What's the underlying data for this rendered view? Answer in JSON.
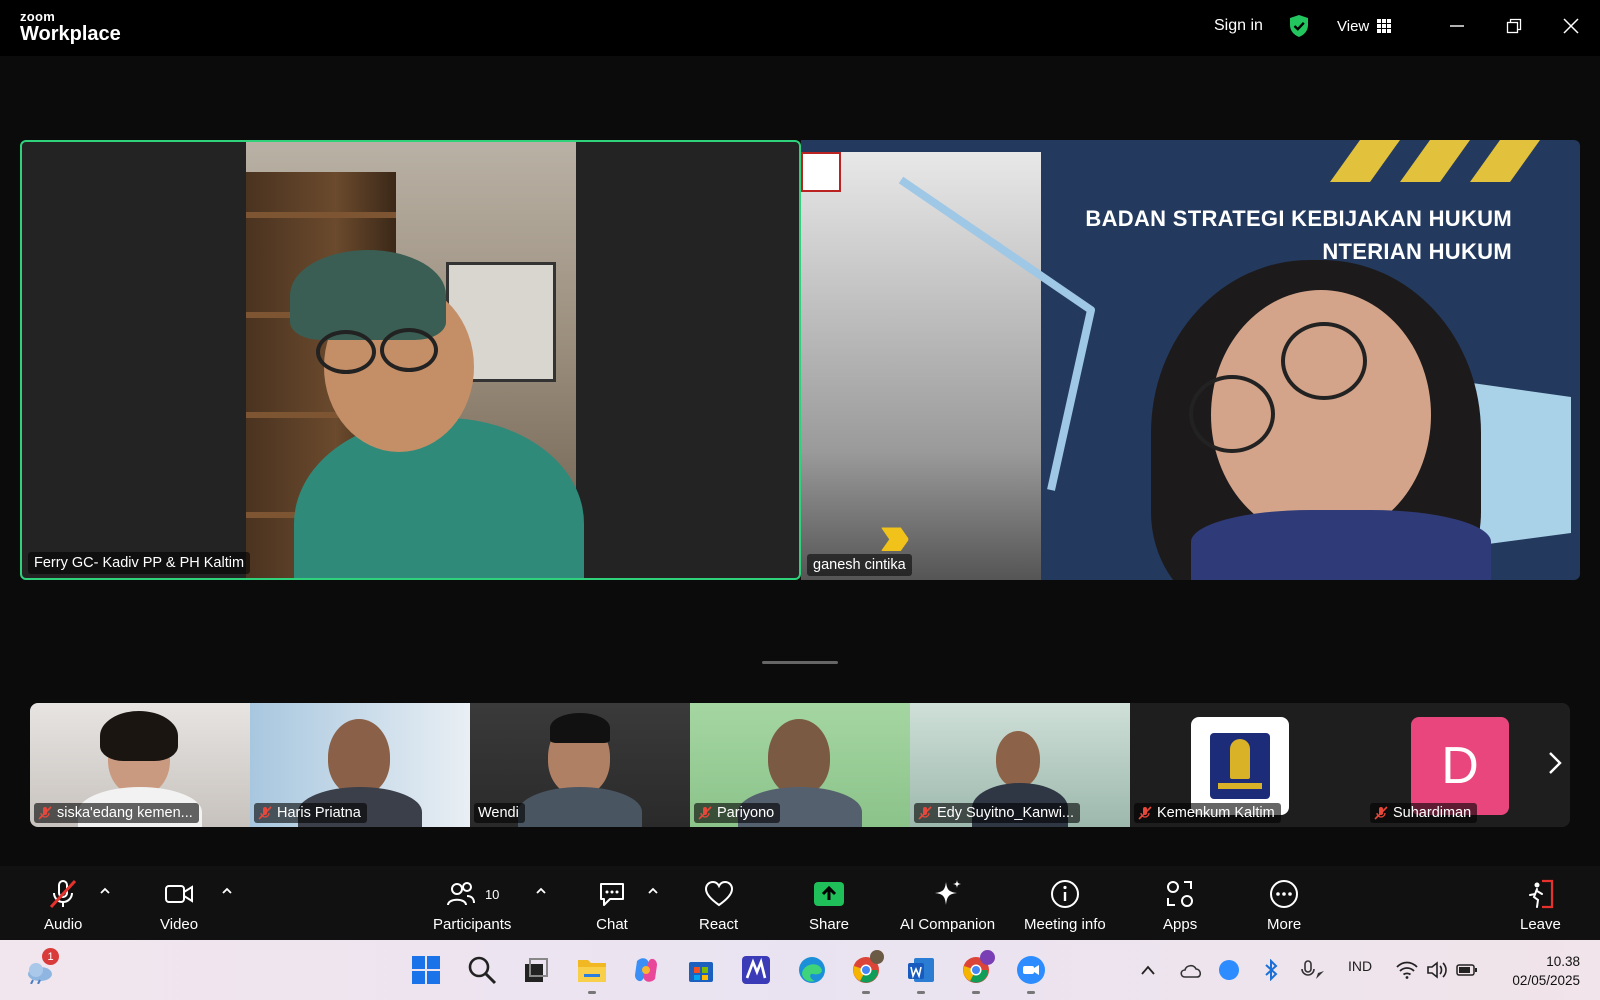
{
  "app": {
    "brand_small": "zoom",
    "brand_large": "Workplace"
  },
  "titlebar": {
    "sign_in": "Sign in",
    "view_label": "View",
    "security_color": "#22c55e"
  },
  "main_tiles": [
    {
      "name": "Ferry GC- Kadiv PP & PH Kaltim",
      "active_speaker": true
    },
    {
      "name": "ganesh cintika",
      "slide_title_line1": "BADAN STRATEGI KEBIJAKAN HUKUM",
      "slide_title_line2": "NTERIAN HUKUM"
    }
  ],
  "thumbnails": [
    {
      "name": "siska'edang kemen...",
      "muted": true
    },
    {
      "name": "Haris Priatna",
      "muted": true
    },
    {
      "name": "Wendi",
      "muted": false
    },
    {
      "name": "Pariyono",
      "muted": true
    },
    {
      "name": "Edy Suyitno_Kanwi...",
      "muted": true
    },
    {
      "name": "Kemenkum Kaltim",
      "muted": true
    },
    {
      "name": "Suhardiman",
      "muted": true,
      "avatar_letter": "D",
      "avatar_color": "#e8467c"
    }
  ],
  "toolbar": {
    "audio": "Audio",
    "video": "Video",
    "participants": "Participants",
    "participants_count": "10",
    "chat": "Chat",
    "react": "React",
    "share": "Share",
    "ai_companion": "AI Companion",
    "meeting_info": "Meeting info",
    "apps": "Apps",
    "more": "More",
    "leave": "Leave",
    "share_color": "#1fbf5a",
    "leave_color": "#e5322d"
  },
  "taskbar": {
    "weather_badge": "1",
    "tray_lang": "IND",
    "time": "10.38",
    "date": "02/05/2025"
  }
}
